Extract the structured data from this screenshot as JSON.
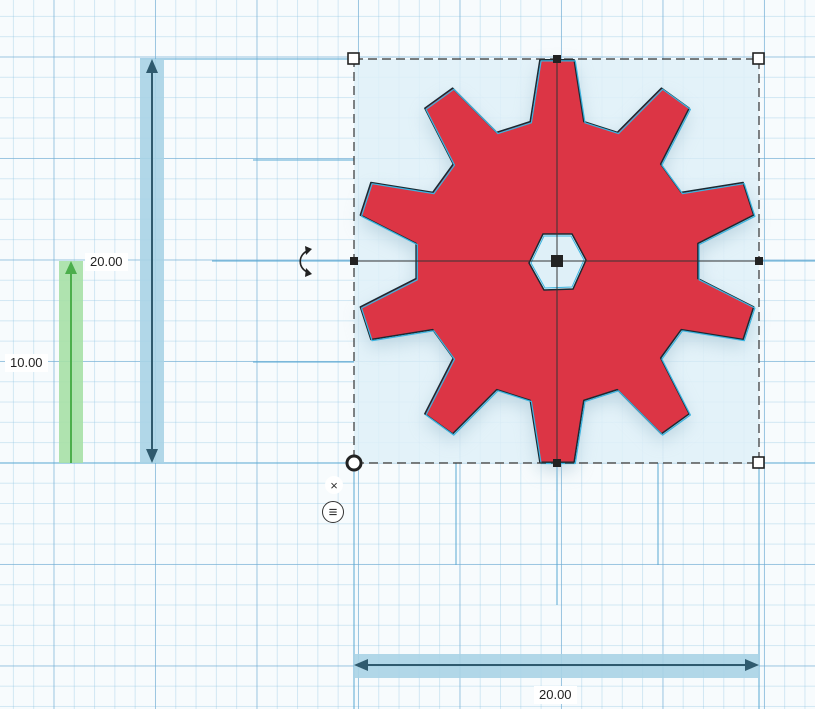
{
  "dimensions": {
    "height_total": "20.00",
    "width_total": "20.00",
    "elevation": "10.00"
  },
  "controls": {
    "close_symbol": "×",
    "menu_symbol": "≡"
  },
  "colors": {
    "shape_fill": "#dc3545",
    "shape_outline": "#3bb4e0",
    "elevation_arrow": "#6fcf6f",
    "dimension_arrow": "#9cc9de",
    "grid": "#6eaad2"
  },
  "icons": {
    "rotate": "rotate-arrow-icon",
    "close": "close-icon",
    "menu": "menu-icon"
  }
}
